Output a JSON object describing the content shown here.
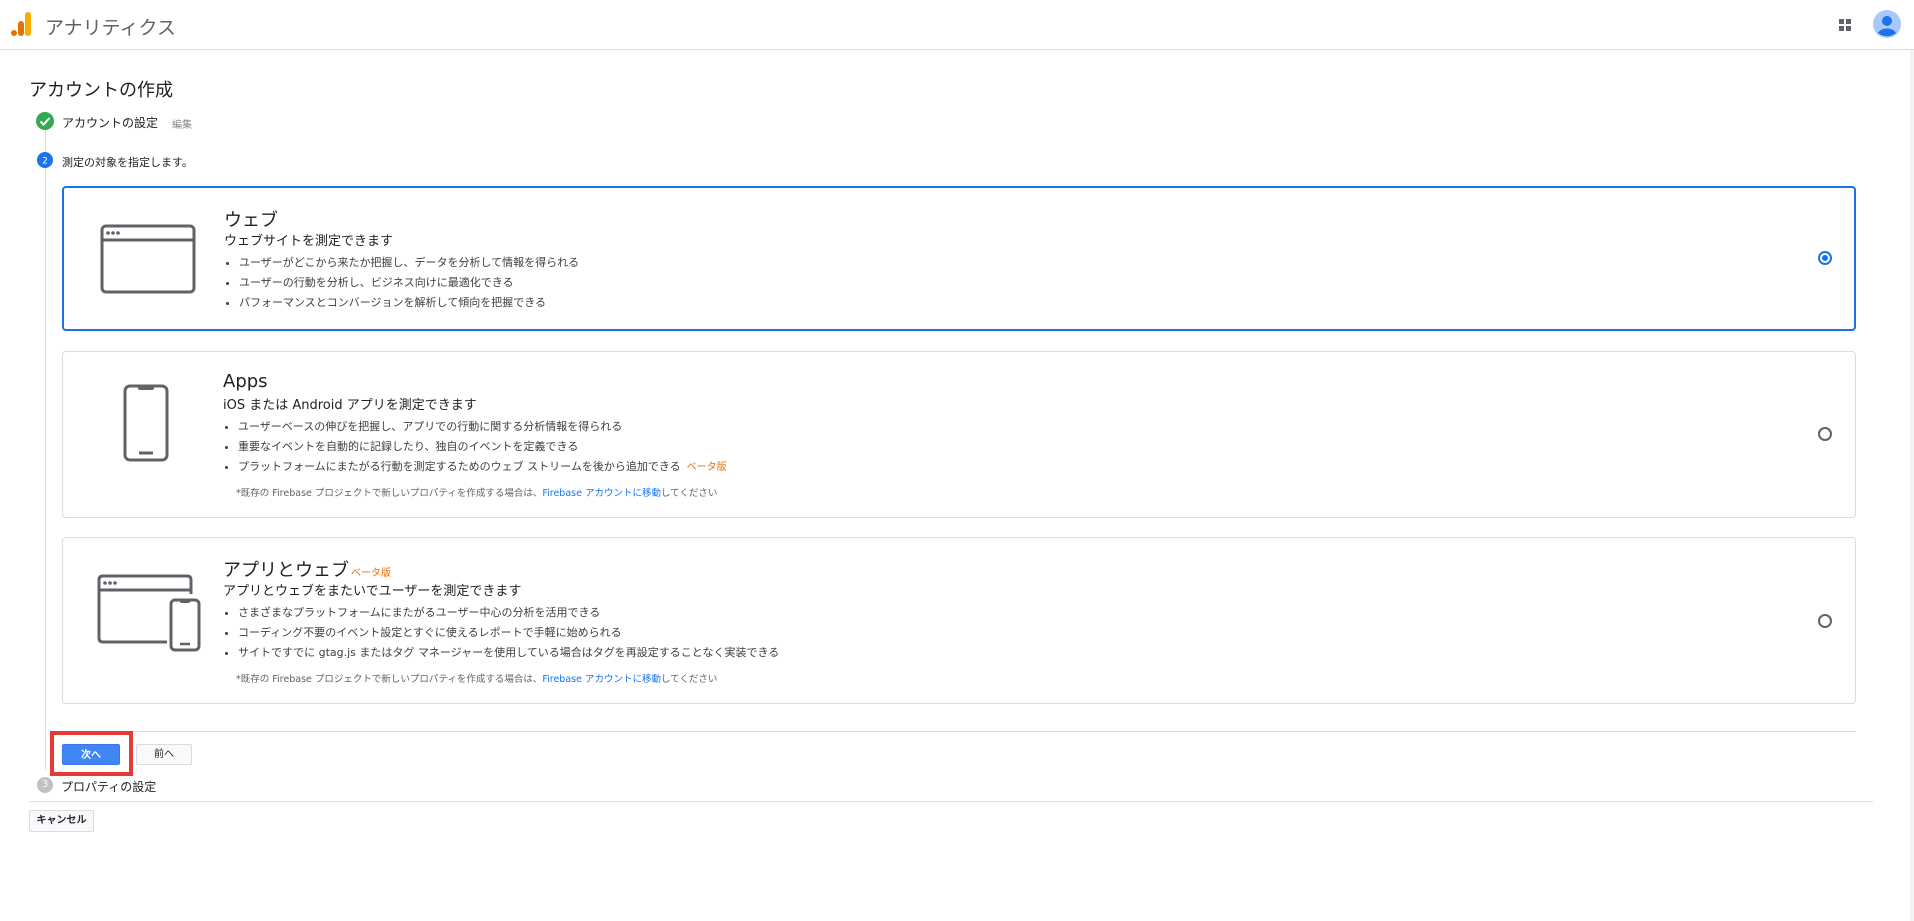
{
  "header": {
    "app_title": "アナリティクス",
    "logo_icon": "analytics-logo-icon",
    "apps_icon": "apps-grid-icon",
    "avatar_icon": "account-avatar-icon"
  },
  "page": {
    "title": "アカウントの作成"
  },
  "steps": {
    "step1": {
      "label": "アカウントの設定",
      "edit": "編集",
      "status_icon": "check-circle-icon"
    },
    "step2": {
      "number": "2",
      "label": "測定の対象を指定します。"
    },
    "step3": {
      "number": "3",
      "label": "プロパティの設定"
    }
  },
  "options": {
    "web": {
      "title": "ウェブ",
      "subtitle": "ウェブサイトを測定できます",
      "bullets": [
        "ユーザーがどこから来たか把握し、データを分析して情報を得られる",
        "ユーザーの行動を分析し、ビジネス向けに最適化できる",
        "パフォーマンスとコンバージョンを解析して傾向を把握できる"
      ],
      "selected": true
    },
    "apps": {
      "title": "Apps",
      "subtitle": "iOS または Android アプリを測定できます",
      "bullets": [
        "ユーザーベースの伸びを把握し、アプリでの行動に関する分析情報を得られる",
        "重要なイベントを自動的に記録したり、独自のイベントを定義できる",
        "プラットフォームにまたがる行動を測定するためのウェブ ストリームを後から追加できる"
      ],
      "beta": "ベータ版",
      "note_prefix": "*既存の Firebase プロジェクトで新しいプロパティを作成する場合は、",
      "note_link": "Firebase アカウントに移動",
      "note_suffix": "してください",
      "selected": false
    },
    "appweb": {
      "title": "アプリとウェブ",
      "beta": "ベータ版",
      "subtitle": "アプリとウェブをまたいでユーザーを測定できます",
      "bullets": [
        "さまざまなプラットフォームにまたがるユーザー中心の分析を活用できる",
        "コーディング不要のイベント設定とすぐに使えるレポートで手軽に始められる",
        "サイトですでに gtag.js またはタグ マネージャーを使用している場合はタグを再設定することなく実装できる"
      ],
      "note_prefix": "*既存の Firebase プロジェクトで新しいプロパティを作成する場合は、",
      "note_link": "Firebase アカウントに移動",
      "note_suffix": "してください",
      "selected": false
    }
  },
  "buttons": {
    "next": "次へ",
    "back": "前へ",
    "cancel": "キャンセル"
  },
  "colors": {
    "accent": "#1a73e8",
    "primary_button": "#4285f4",
    "beta": "#e8710a",
    "success": "#34a853",
    "highlight": "#e53935"
  }
}
